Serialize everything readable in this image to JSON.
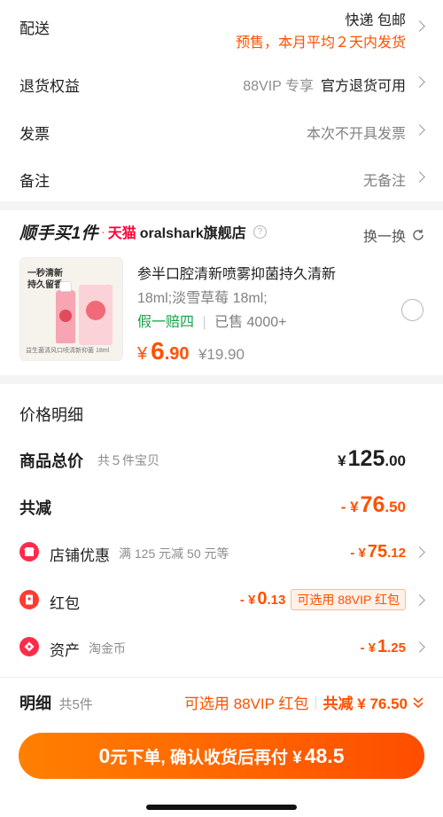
{
  "delivery": {
    "label": "配送",
    "method": "快递 包邮",
    "note": "预售，本月平均２天内发货"
  },
  "returns": {
    "label": "退货权益",
    "vip_tag": "88VIP 专享",
    "value": "官方退货可用"
  },
  "invoice": {
    "label": "发票",
    "value": "本次不开具发票"
  },
  "remark": {
    "label": "备注",
    "value": "无备注"
  },
  "shop": {
    "promo_logo": "顺手买1件",
    "tmall": "天猫",
    "name": "oralshark旗舰店",
    "help_icon": "?",
    "swap_label": "换一换"
  },
  "product": {
    "title": "参半口腔清新喷雾抑菌持久清新",
    "spec": "18ml;淡雪草莓 18ml;",
    "guarantee": "假一赔四",
    "sold": "已售 4000+",
    "price_symbol": "¥",
    "price_int": "6",
    "price_dec": ".90",
    "original_price": "¥19.90",
    "thumb_text_1": "一秒清新",
    "thumb_text_2": "持久留香",
    "thumb_footer": "益生菌清风口喷清新抑菌 18ml"
  },
  "breakdown": {
    "title": "价格明细",
    "total_label": "商品总价",
    "total_sub": "共５件宝贝",
    "total_symbol": "¥",
    "total_int": "125",
    "total_dec": ".00",
    "reduce_label": "共减",
    "reduce_prefix": "- ¥",
    "reduce_int": "76",
    "reduce_dec": ".50",
    "shop_label": "店铺优惠",
    "shop_sub": "满 125 元减 50 元等",
    "shop_prefix": "- ¥",
    "shop_int": "75",
    "shop_dec": ".12",
    "redpacket_label": "红包",
    "redpacket_prefix": "- ¥",
    "redpacket_int": "0",
    "redpacket_dec": ".13",
    "redpacket_tag": "可选用 88VIP 红包",
    "asset_label": "资产",
    "asset_sub": "淘金币",
    "asset_prefix": "- ¥",
    "asset_int": "1",
    "asset_dec": ".25"
  },
  "footer": {
    "detail_label": "明细",
    "detail_count": "共5件",
    "vip_hint": "可选用 88VIP 红包",
    "reduce_total": "共减 ¥ 76.50",
    "button_zero": "0",
    "button_text": "元下单, 确认收货后再付 ¥",
    "button_amount": "48.5"
  },
  "colors": {
    "accent": "#ff5000",
    "button_start": "#ff7a00",
    "button_end": "#ff5000"
  }
}
